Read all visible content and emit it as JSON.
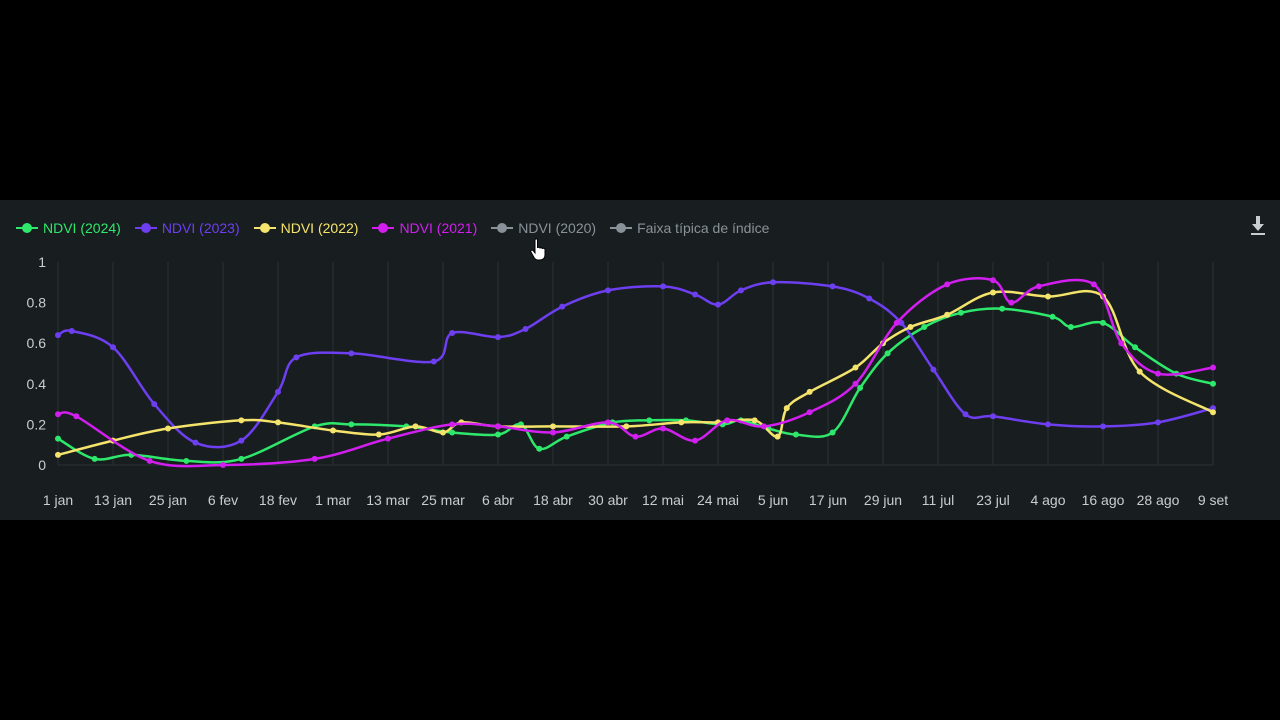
{
  "legend": {
    "items": [
      {
        "label": "NDVI (2024)",
        "color": "#2ee86b",
        "active": true
      },
      {
        "label": "NDVI (2023)",
        "color": "#6d3ff0",
        "active": true
      },
      {
        "label": "NDVI (2022)",
        "color": "#f4e46c",
        "active": true
      },
      {
        "label": "NDVI (2021)",
        "color": "#d21ff0",
        "active": true
      },
      {
        "label": "NDVI (2020)",
        "color": "#8a9299",
        "active": false
      },
      {
        "label": "Faixa típica de índice",
        "color": "#8a9299",
        "active": false
      }
    ]
  },
  "toolbar": {
    "download_icon": "download-icon"
  },
  "chart_data": {
    "type": "line",
    "x_unit": "day of year",
    "xlim": [
      1,
      253
    ],
    "ylim": [
      0,
      1
    ],
    "y_ticks": [
      0,
      0.2,
      0.4,
      0.6,
      0.8,
      1
    ],
    "y_tick_labels": [
      "0",
      "0.2",
      "0.4",
      "0.6",
      "0.8",
      "1"
    ],
    "x_ticks": [
      1,
      13,
      25,
      37,
      49,
      61,
      73,
      85,
      97,
      109,
      121,
      133,
      145,
      157,
      169,
      181,
      193,
      205,
      217,
      229,
      241,
      253
    ],
    "x_tick_labels": [
      "1 jan",
      "13 jan",
      "25 jan",
      "6 fev",
      "18 fev",
      "1 mar",
      "13 mar",
      "25 mar",
      "6 abr",
      "18 abr",
      "30 abr",
      "12 mai",
      "24 mai",
      "5 jun",
      "17 jun",
      "29 jun",
      "11 jul",
      "23 jul",
      "4 ago",
      "16 ago",
      "28 ago",
      "9 set"
    ],
    "grid": true,
    "series": [
      {
        "name": "NDVI (2024)",
        "color": "#2ee86b",
        "x": [
          1,
          9,
          17,
          29,
          41,
          57,
          65,
          77,
          87,
          97,
          102,
          106,
          112,
          122,
          130,
          138,
          146,
          150,
          156,
          162,
          170,
          176,
          182,
          190,
          198,
          207,
          218,
          222,
          229,
          236,
          245,
          253
        ],
        "y": [
          0.13,
          0.03,
          0.05,
          0.02,
          0.03,
          0.19,
          0.2,
          0.19,
          0.16,
          0.15,
          0.2,
          0.08,
          0.14,
          0.21,
          0.22,
          0.22,
          0.2,
          0.22,
          0.18,
          0.15,
          0.16,
          0.38,
          0.55,
          0.68,
          0.75,
          0.77,
          0.73,
          0.68,
          0.7,
          0.58,
          0.45,
          0.4
        ]
      },
      {
        "name": "NDVI (2023)",
        "color": "#6d3ff0",
        "x": [
          1,
          4,
          13,
          22,
          31,
          41,
          49,
          53,
          65,
          83,
          87,
          97,
          103,
          111,
          121,
          133,
          140,
          145,
          150,
          157,
          170,
          178,
          185,
          192,
          199,
          205,
          217,
          229,
          241,
          253
        ],
        "y": [
          0.64,
          0.66,
          0.58,
          0.3,
          0.11,
          0.12,
          0.36,
          0.53,
          0.55,
          0.51,
          0.65,
          0.63,
          0.67,
          0.78,
          0.86,
          0.88,
          0.84,
          0.79,
          0.86,
          0.9,
          0.88,
          0.82,
          0.7,
          0.47,
          0.25,
          0.24,
          0.2,
          0.19,
          0.21,
          0.28
        ]
      },
      {
        "name": "NDVI (2022)",
        "color": "#f4e46c",
        "x": [
          1,
          13,
          25,
          41,
          49,
          61,
          71,
          79,
          85,
          89,
          97,
          109,
          125,
          137,
          145,
          153,
          158,
          160,
          165,
          175,
          181,
          187,
          195,
          205,
          217,
          229,
          237,
          253
        ],
        "y": [
          0.05,
          0.12,
          0.18,
          0.22,
          0.21,
          0.17,
          0.15,
          0.19,
          0.16,
          0.21,
          0.19,
          0.19,
          0.19,
          0.21,
          0.21,
          0.22,
          0.14,
          0.28,
          0.36,
          0.48,
          0.6,
          0.68,
          0.74,
          0.85,
          0.83,
          0.83,
          0.46,
          0.26
        ]
      },
      {
        "name": "NDVI (2021)",
        "color": "#d21ff0",
        "x": [
          1,
          5,
          21,
          37,
          57,
          73,
          87,
          97,
          109,
          121,
          127,
          133,
          140,
          147,
          155,
          165,
          175,
          184,
          195,
          205,
          209,
          215,
          227,
          233,
          241,
          253
        ],
        "y": [
          0.25,
          0.24,
          0.02,
          0.0,
          0.03,
          0.13,
          0.2,
          0.19,
          0.16,
          0.21,
          0.14,
          0.18,
          0.12,
          0.22,
          0.19,
          0.26,
          0.4,
          0.7,
          0.89,
          0.91,
          0.8,
          0.88,
          0.89,
          0.6,
          0.45,
          0.48
        ]
      }
    ]
  }
}
